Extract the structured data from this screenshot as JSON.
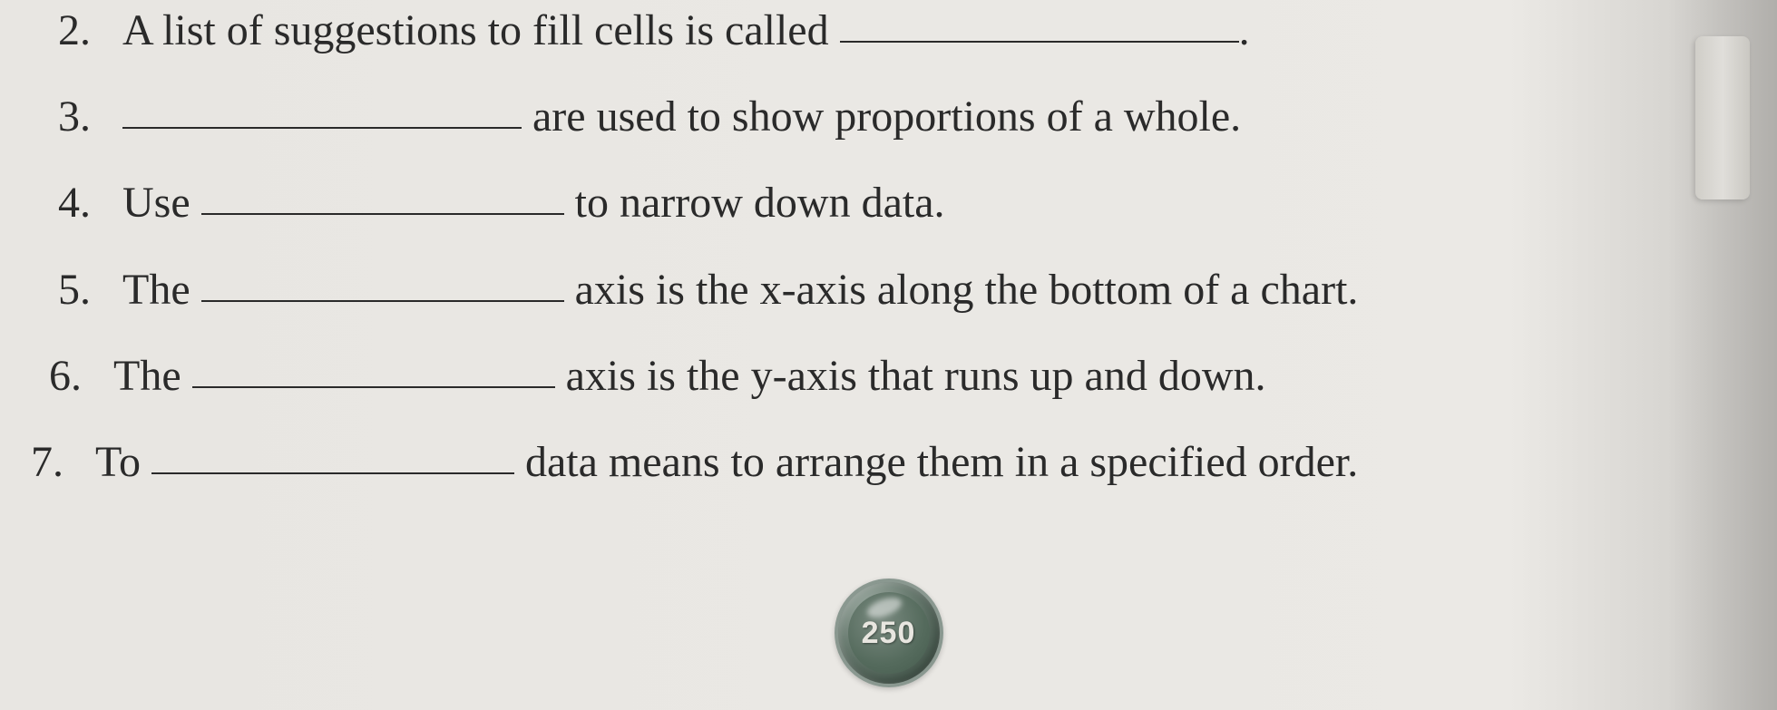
{
  "questions": {
    "q2": {
      "number": "2.",
      "text_before": "A list of suggestions to fill cells is called ",
      "text_after": "."
    },
    "q3": {
      "number": "3.",
      "text_before": "",
      "text_after": " are used to show proportions of a whole."
    },
    "q4": {
      "number": "4.",
      "text_before": "Use ",
      "text_after": " to narrow down data."
    },
    "q5": {
      "number": "5.",
      "text_before": "The ",
      "text_after": " axis is the x-axis along the bottom of a chart."
    },
    "q6": {
      "number": "6.",
      "text_before": "The ",
      "text_after": " axis is the y-axis that runs up and down."
    },
    "q7": {
      "number": "7.",
      "text_before": "To ",
      "text_after": " data means to arrange them in a specified order."
    }
  },
  "page_number": "250"
}
